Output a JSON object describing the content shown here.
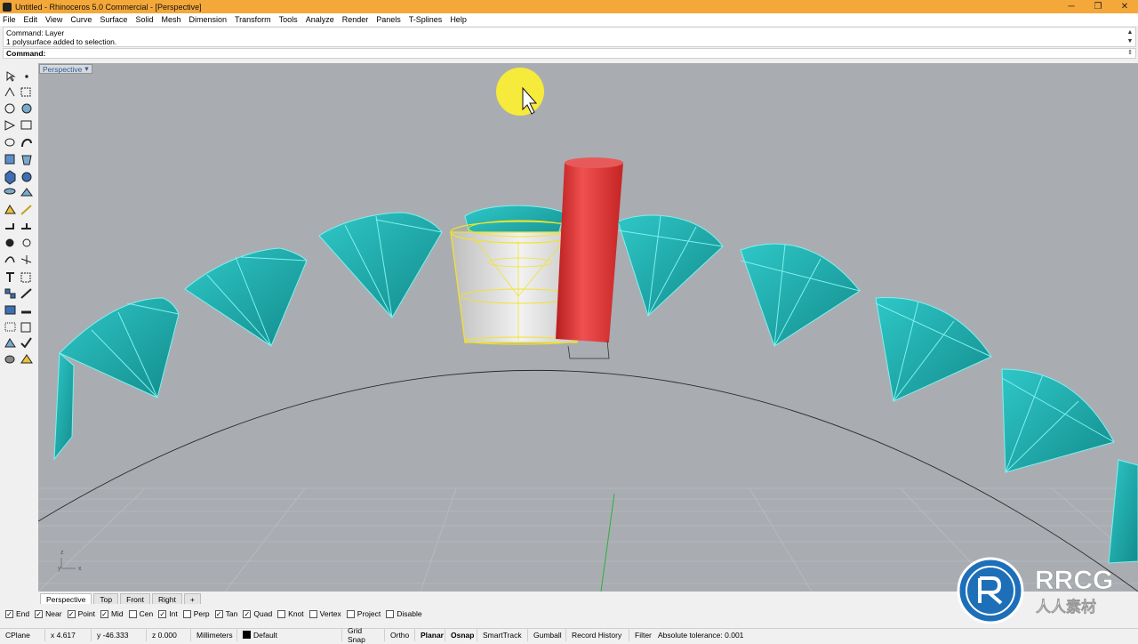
{
  "window": {
    "title": "Untitled - Rhinoceros 5.0 Commercial - [Perspective]",
    "minimize_glyph": "─",
    "restore_glyph": "❐",
    "close_glyph": "✕"
  },
  "menu": [
    "File",
    "Edit",
    "View",
    "Curve",
    "Surface",
    "Solid",
    "Mesh",
    "Dimension",
    "Transform",
    "Tools",
    "Analyze",
    "Render",
    "Panels",
    "T-Splines",
    "Help"
  ],
  "command_history": {
    "line1": "Command: Layer",
    "line2": "1 polysurface added to selection."
  },
  "command_prompt": {
    "label": "Command:",
    "value": ""
  },
  "viewport": {
    "label": "Perspective",
    "dropdown_glyph": "▾",
    "axis_z": "z",
    "axis_y": "y",
    "axis_x": "x"
  },
  "view_tabs": [
    "Perspective",
    "Top",
    "Front",
    "Right"
  ],
  "view_tabs_add": "+",
  "osnaps": [
    {
      "label": "End",
      "checked": true
    },
    {
      "label": "Near",
      "checked": true
    },
    {
      "label": "Point",
      "checked": true
    },
    {
      "label": "Mid",
      "checked": true
    },
    {
      "label": "Cen",
      "checked": false
    },
    {
      "label": "Int",
      "checked": true
    },
    {
      "label": "Perp",
      "checked": false
    },
    {
      "label": "Tan",
      "checked": true
    },
    {
      "label": "Quad",
      "checked": true
    },
    {
      "label": "Knot",
      "checked": false
    },
    {
      "label": "Vertex",
      "checked": false
    },
    {
      "label": "Project",
      "checked": false
    },
    {
      "label": "Disable",
      "checked": false
    }
  ],
  "status": {
    "cplane": "CPlane",
    "x": "x 4.617",
    "y": "y -46.333",
    "z": "z 0.000",
    "units": "Millimeters",
    "layer": "Default",
    "grid_snap": "Grid Snap",
    "ortho": "Ortho",
    "planar": "Planar",
    "osnap": "Osnap",
    "smarttrack": "SmartTrack",
    "gumball": "Gumball",
    "record_history": "Record History",
    "filter": "Filter",
    "tolerance": "Absolute tolerance: 0.001"
  },
  "watermark": {
    "brand": "RRCG",
    "subtitle": "人人素材"
  },
  "colors": {
    "titlebar": "#f4a83a",
    "viewport_bg": "#a9adb2",
    "gem": "#1fb3b3",
    "gem_edge": "#7ff0f0",
    "selected_cylinder": "#e03434",
    "selected_cup_outline": "#f2e32a",
    "cursor_highlight": "#f6ea3a"
  }
}
